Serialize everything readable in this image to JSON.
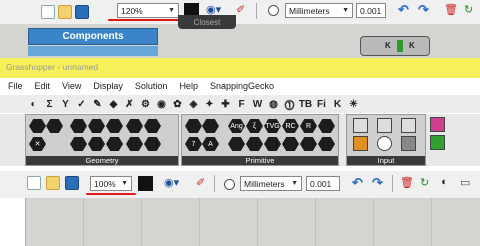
{
  "top_toolbar": {
    "zoom_value": "120%",
    "units_value": "Millimeters",
    "tolerance_value": "0.001",
    "closest_label": "Closest",
    "components_label": "Components"
  },
  "canvas_node": {
    "label_k1": "K",
    "label_k2": "K"
  },
  "window": {
    "title": "Grasshopper - unnamed"
  },
  "menu": [
    "File",
    "Edit",
    "View",
    "Display",
    "Solution",
    "Help",
    "SnappingGecko"
  ],
  "tabs": [
    "◐",
    "Σ",
    "Y",
    "✓",
    "✎",
    "◆",
    "✗",
    "⚙",
    "◉",
    "✿",
    "◈",
    "✦",
    "✚",
    "F",
    "W",
    "◍",
    "⓵",
    "TB",
    "Fi",
    "K",
    "☀"
  ],
  "panels": {
    "geometry_label": "Geometry",
    "primitive_label": "Primitive",
    "input_label": "Input",
    "primitive_tags": [
      "Ang",
      "ξ",
      "TVG",
      "RC",
      "R",
      "",
      "7",
      "A",
      "",
      "",
      "",
      "",
      ""
    ]
  },
  "bottom_toolbar": {
    "zoom_value": "100%",
    "units_value": "Millimeters",
    "tolerance_value": "0.001"
  },
  "colors": {
    "highlight": "#f6f05a",
    "components_blue": "#3b84c9",
    "annotation_red": "#e01818"
  }
}
